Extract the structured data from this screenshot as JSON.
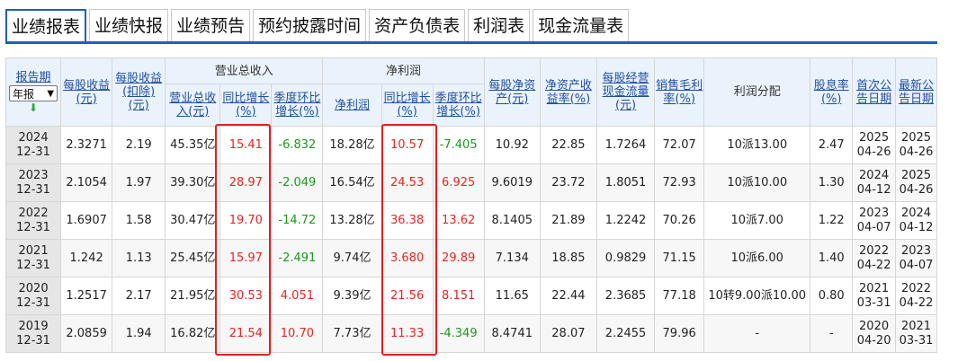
{
  "tabs": [
    "业绩报表",
    "业绩快报",
    "业绩预告",
    "预约披露时间",
    "资产负债表",
    "利润表",
    "现金流量表"
  ],
  "header": {
    "report_period": "报告期",
    "select_value": "年报",
    "eps": "每股收益(元)",
    "eps_deducted": "每股收益(扣除)(元)",
    "revenue_group": "营业总收入",
    "revenue": "营业总收入(元)",
    "revenue_yoy": "同比增长(%)",
    "revenue_qoq": "季度环比增长(%)",
    "profit_group": "净利润",
    "net_profit": "净利润",
    "profit_yoy": "同比增长(%)",
    "profit_qoq": "季度环比增长(%)",
    "bvps": "每股净资产(元)",
    "roe": "净资产收益率(%)",
    "ocfps": "每股经营现金流量(元)",
    "gross_margin": "销售毛利率(%)",
    "dividend": "利润分配",
    "dividend_yield": "股息率(%)",
    "first_date": "首次公告日期",
    "latest_date": "最新公告日期"
  },
  "rows": [
    {
      "period": "2024 12-31",
      "eps": "2.3271",
      "eps_d": "2.19",
      "rev": "45.35亿",
      "rev_yoy": "15.41",
      "rev_qoq": "-6.832",
      "np": "18.28亿",
      "np_yoy": "10.57",
      "np_qoq": "-7.405",
      "bvps": "10.92",
      "roe": "22.85",
      "ocf": "1.7264",
      "gm": "72.07",
      "div": "10派13.00",
      "dy": "2.47",
      "first": "2025 04-26",
      "latest": "2025 04-26"
    },
    {
      "period": "2023 12-31",
      "eps": "2.1054",
      "eps_d": "1.97",
      "rev": "39.30亿",
      "rev_yoy": "28.97",
      "rev_qoq": "-2.049",
      "np": "16.54亿",
      "np_yoy": "24.53",
      "np_qoq": "6.925",
      "bvps": "9.6019",
      "roe": "23.72",
      "ocf": "1.8051",
      "gm": "72.93",
      "div": "10派10.00",
      "dy": "1.30",
      "first": "2024 04-12",
      "latest": "2025 04-26"
    },
    {
      "period": "2022 12-31",
      "eps": "1.6907",
      "eps_d": "1.58",
      "rev": "30.47亿",
      "rev_yoy": "19.70",
      "rev_qoq": "-14.72",
      "np": "13.28亿",
      "np_yoy": "36.38",
      "np_qoq": "13.62",
      "bvps": "8.1405",
      "roe": "21.89",
      "ocf": "1.2242",
      "gm": "70.26",
      "div": "10派7.00",
      "dy": "1.22",
      "first": "2023 04-07",
      "latest": "2024 04-12"
    },
    {
      "period": "2021 12-31",
      "eps": "1.242",
      "eps_d": "1.13",
      "rev": "25.45亿",
      "rev_yoy": "15.97",
      "rev_qoq": "-2.491",
      "np": "9.74亿",
      "np_yoy": "3.680",
      "np_qoq": "29.89",
      "bvps": "7.134",
      "roe": "18.85",
      "ocf": "0.9829",
      "gm": "71.15",
      "div": "10派6.00",
      "dy": "1.40",
      "first": "2022 04-22",
      "latest": "2023 04-07"
    },
    {
      "period": "2020 12-31",
      "eps": "1.2517",
      "eps_d": "2.17",
      "rev": "21.95亿",
      "rev_yoy": "30.53",
      "rev_qoq": "4.051",
      "np": "9.39亿",
      "np_yoy": "21.56",
      "np_qoq": "8.151",
      "bvps": "11.65",
      "roe": "22.44",
      "ocf": "2.3685",
      "gm": "77.18",
      "div": "10转9.00派10.00",
      "dy": "0.80",
      "first": "2021 03-31",
      "latest": "2022 04-22"
    },
    {
      "period": "2019 12-31",
      "eps": "2.0859",
      "eps_d": "1.94",
      "rev": "16.82亿",
      "rev_yoy": "21.54",
      "rev_qoq": "10.70",
      "np": "7.73亿",
      "np_yoy": "11.33",
      "np_qoq": "-4.349",
      "bvps": "8.4741",
      "roe": "28.07",
      "ocf": "2.2455",
      "gm": "79.96",
      "div": "-",
      "dy": "-",
      "first": "2020 04-20",
      "latest": "2021 03-31"
    }
  ],
  "colors": {
    "accent": "#1f5fbf",
    "up": "#e8251f",
    "down": "#1a9a1a",
    "highlight": "#e02020"
  }
}
